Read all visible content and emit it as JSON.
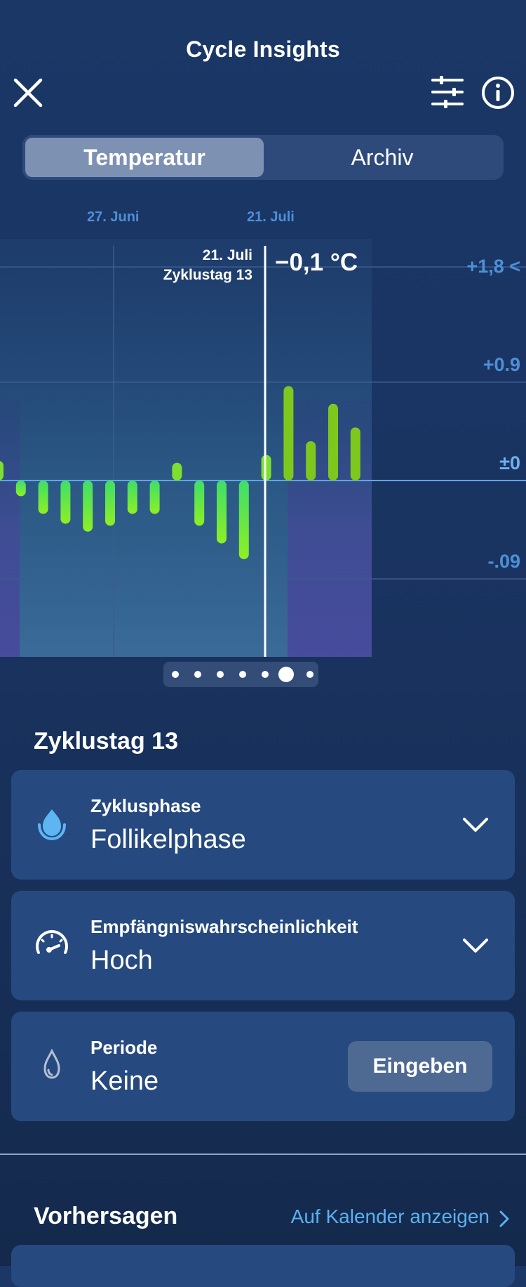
{
  "header": {
    "title": "Cycle Insights",
    "close_icon": "close-icon",
    "filter_icon": "sliders-icon",
    "info_icon": "info-icon"
  },
  "tabs": [
    {
      "label": "Temperatur",
      "selected": true
    },
    {
      "label": "Archiv",
      "selected": false
    }
  ],
  "chart_data": {
    "type": "bar",
    "date_labels": [
      "27. Juni",
      "21. Juli"
    ],
    "y_ticks": [
      "+1,8 <",
      "+0.9",
      "±0",
      "-.09"
    ],
    "values": [
      0.1,
      -0.08,
      -0.17,
      -0.22,
      -0.26,
      -0.23,
      -0.17,
      -0.17,
      0.09,
      -0.23,
      -0.32,
      -0.4,
      0.13,
      0.48,
      0.2,
      0.39,
      0.27
    ],
    "selected": {
      "date": "21. Juli",
      "cycle_day": "Zyklustag 13",
      "value_label": "−0,1 °C"
    },
    "colors": {
      "negative": "#4cea5c",
      "positive": "#7ec81e",
      "cursor": "#ffffff"
    }
  },
  "pager": {
    "count": 7,
    "active_index": 5
  },
  "cycle_day": {
    "title": "Zyklustag 13",
    "cards": [
      {
        "label": "Zyklusphase",
        "value": "Follikelphase",
        "icon": "drop-icon"
      },
      {
        "label": "Empfängniswahrscheinlichkeit",
        "value": "Hoch",
        "icon": "gauge-icon"
      },
      {
        "label": "Periode",
        "value": "Keine",
        "icon": "drop-outline-icon",
        "button": "Eingeben"
      }
    ]
  },
  "predictions": {
    "title": "Vorhersagen",
    "link": "Auf Kalender anzeigen"
  }
}
